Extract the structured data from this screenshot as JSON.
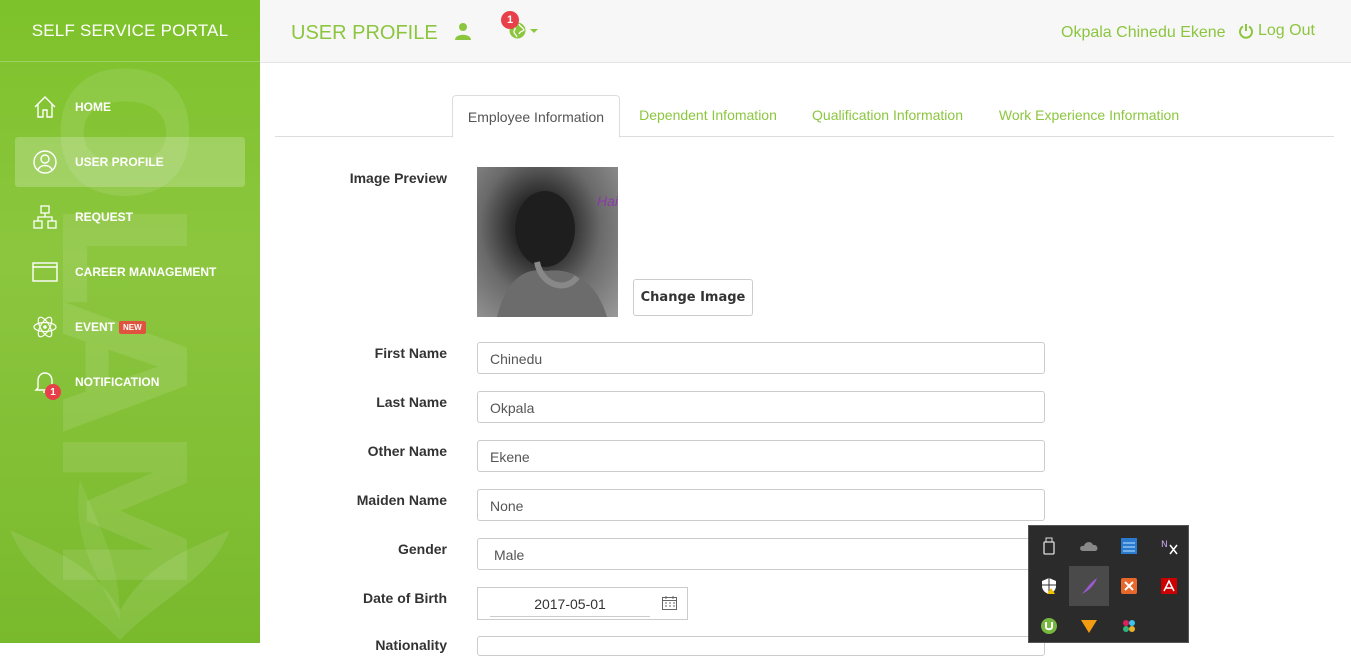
{
  "app": {
    "title": "SELF SERVICE PORTAL"
  },
  "sidebar": {
    "items": [
      {
        "label": "HOME",
        "icon": "home-icon"
      },
      {
        "label": "USER PROFILE",
        "icon": "user-circle-icon",
        "active": true
      },
      {
        "label": "REQUEST",
        "icon": "sitemap-icon"
      },
      {
        "label": "CAREER MANAGEMENT",
        "icon": "browser-window-icon"
      },
      {
        "label": "EVENT",
        "icon": "atom-icon",
        "badge": "NEW"
      },
      {
        "label": "NOTIFICATION",
        "icon": "bell-icon",
        "count": "1"
      }
    ],
    "watermark": "OLAM"
  },
  "header": {
    "page_title": "USER PROFILE",
    "globe_badge": "1",
    "user_name": "Okpala Chinedu Ekene",
    "logout_label": "Log Out"
  },
  "tabs": [
    {
      "label": "Employee Information",
      "active": true
    },
    {
      "label": "Dependent Infomation"
    },
    {
      "label": "Qualification Information"
    },
    {
      "label": "Work Experience Information"
    }
  ],
  "form": {
    "image_preview_label": "Image Preview",
    "image_text": "Hai",
    "change_image_label": "Change Image",
    "first_name": {
      "label": "First Name",
      "value": "Chinedu"
    },
    "last_name": {
      "label": "Last Name",
      "value": "Okpala"
    },
    "other_name": {
      "label": "Other Name",
      "value": "Ekene"
    },
    "maiden_name": {
      "label": "Maiden Name",
      "value": "None"
    },
    "gender": {
      "label": "Gender",
      "value": "Male"
    },
    "dob": {
      "label": "Date of Birth",
      "value": "2017-05-01"
    },
    "nationality": {
      "label": "Nationality"
    }
  },
  "tray": {
    "icons": [
      "usb-drive-icon",
      "onedrive-cloud-icon",
      "network-monitor-icon",
      "onenote-clip-icon",
      "security-shield-icon",
      "feather-pen-icon",
      "xampp-icon",
      "adobe-icon",
      "utorrent-icon",
      "vlc-cone-icon",
      "slack-icon"
    ]
  },
  "colors": {
    "accent": "#8cc63f",
    "badge": "#e8404a",
    "new_badge": "#e0533f"
  }
}
